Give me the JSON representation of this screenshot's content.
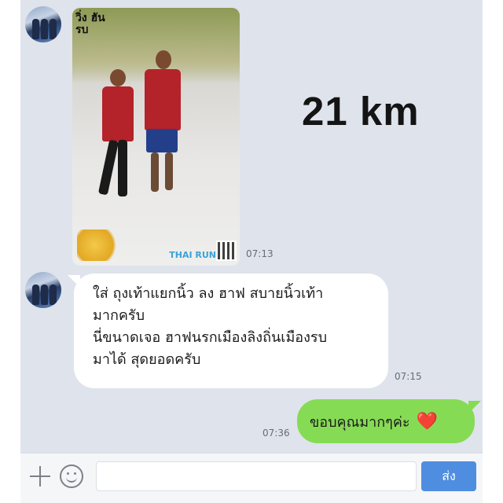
{
  "chat": {
    "photo_message": {
      "time": "07:13"
    },
    "sticker_text": "21 km",
    "received_message": {
      "lines": [
        "ใส่ ถุงเท้าแยกนิ้ว ลง ฮาฟ สบายนิ้วเท้า",
        "มากครับ",
        "นี่ขนาดเจอ ฮาฟนรกเมืองลิงถิ่นเมืองรบ",
        "มาได้ สุดยอดครับ"
      ],
      "time": "07:15"
    },
    "sent_message": {
      "text": "ขอบคุณมากๆค่ะ",
      "emoji": "❤️",
      "time": "07:36"
    }
  },
  "photo_logos": {
    "top_left": "วิ่ง ฮัน รบ",
    "bottom_right": "THAI RUN"
  },
  "input_bar": {
    "placeholder": "",
    "send_label": "ส่ง"
  },
  "colors": {
    "background": "#dfe3ec",
    "sent_bubble": "#86db54",
    "received_bubble": "#ffffff",
    "send_button": "#4f8de0"
  }
}
